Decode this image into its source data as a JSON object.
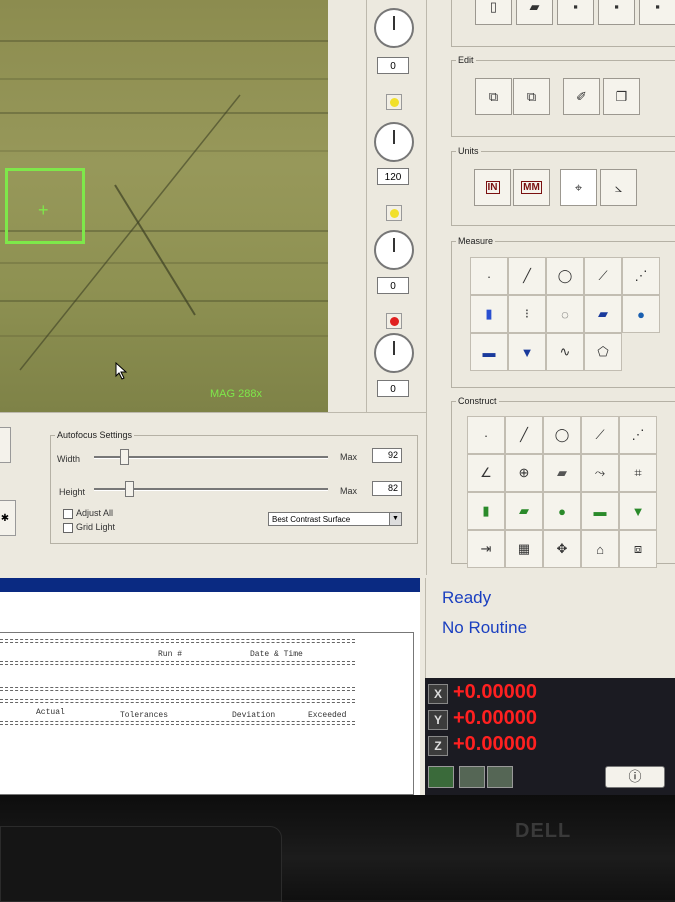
{
  "camera": {
    "magnification": "MAG 288x"
  },
  "lights": {
    "values": [
      "0",
      "120",
      "0",
      "0"
    ]
  },
  "right_panel": {
    "edit_label": "Edit",
    "units_label": "Units",
    "units_in": "IN",
    "units_mm": "MM",
    "measure_label": "Measure",
    "construct_label": "Construct"
  },
  "autofocus": {
    "title": "Autofocus Settings",
    "width_label": "Width",
    "width_max_label": "Max",
    "width_value": "92",
    "height_label": "Height",
    "height_max_label": "Max",
    "height_value": "82",
    "adjust_all_label": "Adjust All",
    "grid_light_label": "Grid Light",
    "mode_selected": "Best Contrast Surface"
  },
  "report": {
    "header_run": "Run #",
    "header_date": "Date & Time",
    "col_actual": "Actual",
    "col_tolerances": "Tolerances",
    "col_deviation": "Deviation",
    "col_exceeded": "Exceeded"
  },
  "status": {
    "line1": "Ready",
    "line2": "No Routine"
  },
  "dro": {
    "x_label": "X",
    "x_value": "+0.00000",
    "y_label": "Y",
    "y_value": "+0.00000",
    "z_label": "Z",
    "z_value": "+0.00000",
    "power_glyph": "ⓘ"
  },
  "monitor": {
    "brand": "DELL"
  },
  "colors": {
    "accent_green": "#7ee84a",
    "dro_red": "#ff2020",
    "status_blue": "#1a3fc0",
    "band_blue": "#0a2a82"
  }
}
